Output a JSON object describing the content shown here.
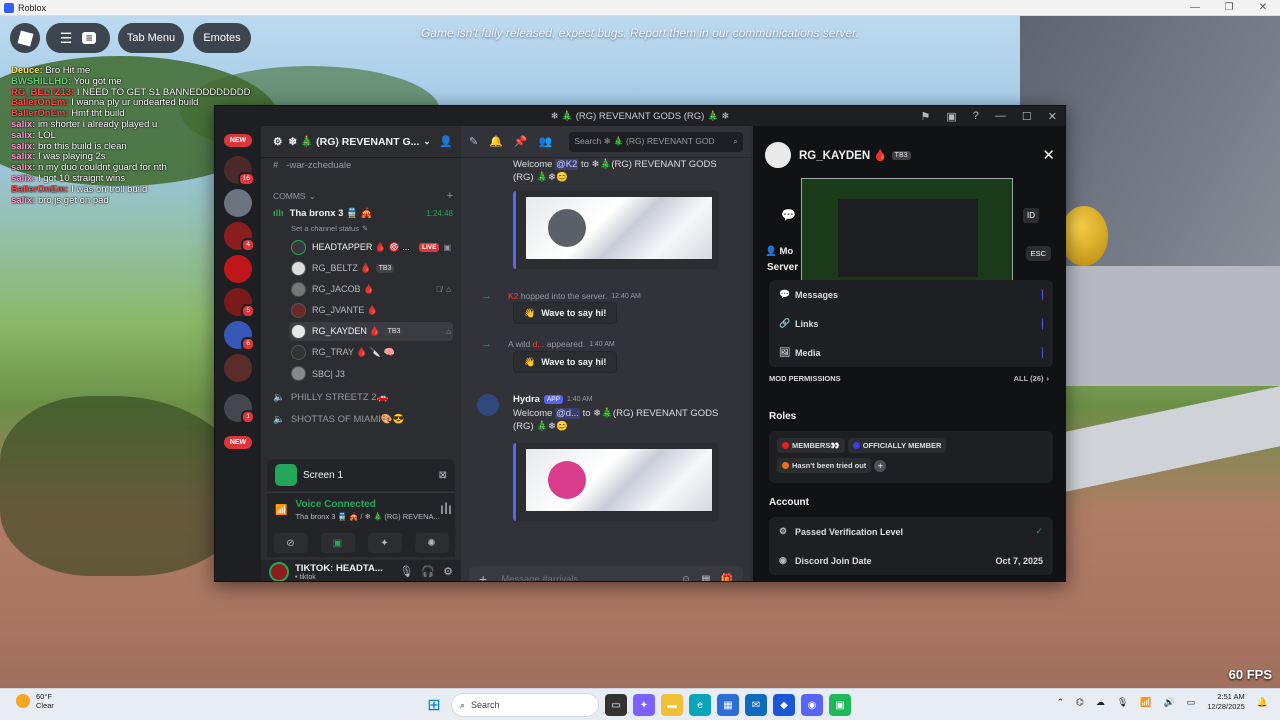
{
  "window": {
    "title": "Roblox"
  },
  "hud": {
    "tab_menu": "Tab Menu",
    "emotes": "Emotes",
    "message": "Game isn't fully released, expect bugs. Report them in our communications server.",
    "fps": "60 FPS"
  },
  "chat": [
    {
      "name": "Deuce:",
      "text": "Bro Hit me",
      "color": "#f5e663"
    },
    {
      "name": "BWSHILLHD:",
      "text": "You got me",
      "color": "#66d17a"
    },
    {
      "name": "RG_BELTZ13:",
      "text": "I NEED TO GET S1 BANNEDDDDDDDDDD",
      "color": "#ff4a4a"
    },
    {
      "name": "BallerOnEm:",
      "text": "I wanna ply ur undearted build",
      "color": "#ff4a4a"
    },
    {
      "name": "BallerOnEm:",
      "text": "Hmf tht build",
      "color": "#ff4a4a"
    },
    {
      "name": "salix:",
      "text": "im shorter i already played u",
      "color": "#ff9bd2"
    },
    {
      "name": "salix:",
      "text": "LOL",
      "color": "#ff9bd2"
    },
    {
      "name": "salix:",
      "text": "bro this build is clean",
      "color": "#ff9bd2"
    },
    {
      "name": "salix:",
      "text": "I was playing 2s",
      "color": "#ff9bd2"
    },
    {
      "name": "salix:",
      "text": "n my duo couldnt guard for nth",
      "color": "#ff9bd2"
    },
    {
      "name": "salix:",
      "text": "I got 10 straignt wins",
      "color": "#ff9bd2"
    },
    {
      "name": "BallerOnEm:",
      "text": "I was on troll build",
      "color": "#ff4a4a"
    },
    {
      "name": "salix:",
      "text": "bro js get on pad",
      "color": "#ff9bd2"
    }
  ],
  "discord": {
    "title": "❄ 🎄 (RG) REVENANT GODS (RG) 🎄 ❄",
    "rail": {
      "badges": [
        {
          "label": "NEW"
        },
        {
          "count": "16"
        },
        {
          "count": "4"
        },
        {
          "count": "5"
        },
        {
          "count": "6"
        },
        {
          "count": "1"
        },
        {
          "label": "NEW"
        }
      ]
    },
    "server_name": "❄ 🎄 (RG) REVENANT G...",
    "channels": {
      "war_schedule": "-war-zcheduale",
      "category": "COMMS",
      "voice_channel": "Tha bronx 3 🚆 🎪",
      "voice_timer": "1:24:48",
      "voice_status": "Set a channel status",
      "users": [
        {
          "name": "HEADTAPPER 🩸 🎯 ...",
          "live": "LIVE"
        },
        {
          "name": "RG_BELTZ 🩸",
          "tag": "TB3"
        },
        {
          "name": "RG_JACOB 🩸"
        },
        {
          "name": "RG_JVANTE 🩸"
        },
        {
          "name": "RG_KAYDEN 🩸",
          "tag": "TB3"
        },
        {
          "name": "RG_TRAY 🩸 🔪 🧠"
        },
        {
          "name": "SBC| J3"
        }
      ],
      "other_voice": [
        {
          "name": "PHILLY STREETZ 2🚗"
        },
        {
          "name": "SHOTTAS OF MIAMI🎨😎"
        }
      ]
    },
    "screen_label": "Screen 1",
    "voice_connected": "Voice Connected",
    "voice_sub": "Tha bronx 3 🚆 🎪 / ❄ 🎄 (RG) REVENA...",
    "user_panel": {
      "name": "TIKTOK: HEADTA...",
      "status": "• tiktok"
    },
    "search_placeholder": "Search ❄ 🎄 (RG) REVENANT GOD",
    "messages": {
      "welcome1_a": "Welcome",
      "welcome1_mention": "@K2",
      "welcome1_b": "to ❄🎄(RG) REVENANT GODS (RG) 🎄❄😊",
      "sys1_user": "K2",
      "sys1_text": "hopped into the server.",
      "sys1_time": "12:40 AM",
      "wave": "Wave to say hi!",
      "sys2_a": "A wild",
      "sys2_user": "d...",
      "sys2_b": "appeared.",
      "sys2_time": "1:40 AM",
      "hydra_name": "Hydra",
      "hydra_app": "APP",
      "hydra_time": "1:40 AM",
      "welcome2_a": "Welcome",
      "welcome2_mention": "@d...",
      "welcome2_b": "to ❄🎄(RG) REVENANT GODS (RG) 🎄❄😊"
    },
    "composer_placeholder": "Message #arrivals",
    "profile": {
      "name": "RG_KAYDEN 🩸",
      "tag": "TB3",
      "id_btn": "ID",
      "esc": "ESC",
      "mod_label": "Mo",
      "server_label": "Server",
      "activity": [
        {
          "label": "Messages"
        },
        {
          "label": "Links"
        },
        {
          "label": "Media"
        }
      ],
      "mod_permissions": "MOD PERMISSIONS",
      "mod_perm_count": "ALL (26)",
      "roles_title": "Roles",
      "roles": [
        {
          "label": "MEMBERS👀",
          "color": "#e81f1f"
        },
        {
          "label": "OFFICIALLY MEMBER",
          "color": "#3a3de8"
        },
        {
          "label": "Hasn't been tried out",
          "color": "#e8711f"
        }
      ],
      "account_title": "Account",
      "verification": "Passed Verification Level",
      "join_label": "Discord Join Date",
      "join_date": "Oct 7, 2025"
    }
  },
  "taskbar": {
    "temp": "60°F",
    "weather": "Clear",
    "search": "Search",
    "time": "2:51 AM",
    "date": "12/28/2025"
  }
}
